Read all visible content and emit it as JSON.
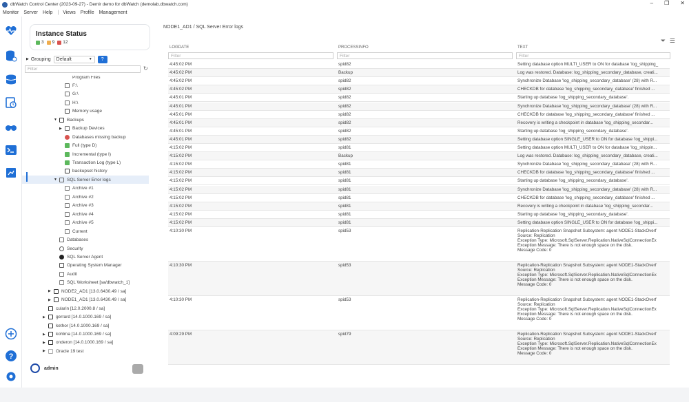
{
  "window": {
    "title": "dbWatch Control Center (2023-09-27) - Demir demo for dbWatch (demolab.dbwatch.com)",
    "minimize": "–",
    "maximize": "❐",
    "close": "✕"
  },
  "menu": [
    "Monitor",
    "Server",
    "Help",
    "|",
    "Views",
    "Profile",
    "Management"
  ],
  "colors": {
    "green": "#5cb85c",
    "orange": "#f0ad4e",
    "red": "#d9534f",
    "accent": "#1f6fd6"
  },
  "status": {
    "title": "Instance Status",
    "green_count": "3",
    "orange_count": "9",
    "red_count": "12"
  },
  "grouping": {
    "label": "Grouping",
    "value": "Default",
    "help": "?"
  },
  "tree_filter_placeholder": "Filter",
  "tree": [
    {
      "label": "Program Files",
      "indent": 3
    },
    {
      "label": "F:\\",
      "indent": 3,
      "icon": "drive-icon"
    },
    {
      "label": "G:\\",
      "indent": 3,
      "icon": "drive-icon"
    },
    {
      "label": "H:\\",
      "indent": 3,
      "icon": "drive-icon"
    },
    {
      "label": "Memory usage",
      "indent": 3,
      "icon": "memory-icon"
    },
    {
      "label": "Backups",
      "indent": 2,
      "icon": "folder-icon",
      "arrow": "▼"
    },
    {
      "label": "Backup Devices",
      "indent": 3,
      "icon": "device-icon",
      "arrow": "▶"
    },
    {
      "label": "Databases missing backup",
      "indent": 3,
      "icon": "error-icon"
    },
    {
      "label": "Full (type D)",
      "indent": 3,
      "icon": "check-icon"
    },
    {
      "label": "Incremental (type I)",
      "indent": 3,
      "icon": "check-icon"
    },
    {
      "label": "Transaction Log (type L)",
      "indent": 3,
      "icon": "check-icon"
    },
    {
      "label": "backupset history",
      "indent": 3,
      "icon": "table-icon"
    },
    {
      "label": "SQL Server Error logs",
      "indent": 2,
      "icon": "log-icon",
      "arrow": "▼",
      "selected": true
    },
    {
      "label": "Archive #1",
      "indent": 3,
      "icon": "doc-icon"
    },
    {
      "label": "Archive #2",
      "indent": 3,
      "icon": "doc-icon"
    },
    {
      "label": "Archive #3",
      "indent": 3,
      "icon": "doc-icon"
    },
    {
      "label": "Archive #4",
      "indent": 3,
      "icon": "doc-icon"
    },
    {
      "label": "Archive #5",
      "indent": 3,
      "icon": "doc-icon"
    },
    {
      "label": "Current",
      "indent": 3,
      "icon": "doc-icon"
    },
    {
      "label": "Databases",
      "indent": 2,
      "icon": "db-icon"
    },
    {
      "label": "Security",
      "indent": 2,
      "icon": "globe-icon"
    },
    {
      "label": "SQL Server Agent",
      "indent": 2,
      "icon": "agent-icon"
    },
    {
      "label": "Operating System Manager",
      "indent": 2,
      "icon": "os-icon"
    },
    {
      "label": "Audit",
      "indent": 2,
      "icon": "doc-icon"
    },
    {
      "label": "SQL Worksheet [sa/dbwatch_1]",
      "indent": 2,
      "icon": "sheet-icon"
    },
    {
      "label": "NODE2_AD1 [13.0.6430.49 / sa]",
      "indent": 1,
      "icon": "server-icon",
      "arrow": "▶"
    },
    {
      "label": "NODE1_AD1 [13.0.6430.49 / sa]",
      "indent": 1,
      "icon": "server-icon",
      "arrow": "▶"
    },
    {
      "label": "cularin [12.0.2000.8 / sa]",
      "indent": 0,
      "icon": "server-icon"
    },
    {
      "label": "gerrard [14.0.1000.169 / sa]",
      "indent": 0,
      "icon": "server-icon",
      "arrow": "▶"
    },
    {
      "label": "kethor [14.0.1000.169 / sa]",
      "indent": 0,
      "icon": "server-icon"
    },
    {
      "label": "kohlma [14.0.1000.169 / sa]",
      "indent": 0,
      "icon": "server-icon",
      "arrow": "▶"
    },
    {
      "label": "onderon [14.0.1000.169 / sa]",
      "indent": 0,
      "icon": "server-icon",
      "arrow": "▶"
    },
    {
      "label": "Oracle 19 test",
      "indent": 0,
      "icon": "oracle-icon",
      "arrow": "▶"
    }
  ],
  "user": {
    "name": "admin"
  },
  "breadcrumb": "NODE1_AD1 / SQL Server Error logs",
  "grid": {
    "columns": [
      "LOGDATE",
      "PROCESSINFO",
      "TEXT"
    ],
    "filter_placeholder": "Filter",
    "rows": [
      {
        "date": "4:45:02 PM",
        "proc": "spid82",
        "text": "Setting database option MULTI_USER to ON for database 'log_shipping_"
      },
      {
        "date": "4:45:02 PM",
        "proc": "Backup",
        "text": "Log was restored. Database: log_shipping_secondary_database, creati..."
      },
      {
        "date": "4:45:02 PM",
        "proc": "spid82",
        "text": "Synchronize Database 'log_shipping_secondary_database' (28) with R..."
      },
      {
        "date": "4:45:02 PM",
        "proc": "spid82",
        "text": "CHECKDB for database 'log_shipping_secondary_database' finished ..."
      },
      {
        "date": "4:45:01 PM",
        "proc": "spid82",
        "text": "Starting up database 'log_shipping_secondary_database'."
      },
      {
        "date": "4:45:01 PM",
        "proc": "spid82",
        "text": "Synchronize Database 'log_shipping_secondary_database' (28) with R..."
      },
      {
        "date": "4:45:01 PM",
        "proc": "spid82",
        "text": "CHECKDB for database 'log_shipping_secondary_database' finished ..."
      },
      {
        "date": "4:45:01 PM",
        "proc": "spid82",
        "text": "Recovery is writing a checkpoint in database 'log_shipping_secondar..."
      },
      {
        "date": "4:45:01 PM",
        "proc": "spid82",
        "text": "Starting up database 'log_shipping_secondary_database'."
      },
      {
        "date": "4:45:01 PM",
        "proc": "spid82",
        "text": "Setting database option SINGLE_USER to ON for database 'log_shippi..."
      },
      {
        "date": "4:15:02 PM",
        "proc": "spid81",
        "text": "Setting database option MULTI_USER to ON for database 'log_shippin..."
      },
      {
        "date": "4:15:02 PM",
        "proc": "Backup",
        "text": "Log was restored. Database: log_shipping_secondary_database, creati..."
      },
      {
        "date": "4:15:02 PM",
        "proc": "spid81",
        "text": "Synchronize Database 'log_shipping_secondary_database' (28) with R..."
      },
      {
        "date": "4:15:02 PM",
        "proc": "spid81",
        "text": "CHECKDB for database 'log_shipping_secondary_database' finished ..."
      },
      {
        "date": "4:15:02 PM",
        "proc": "spid81",
        "text": "Starting up database 'log_shipping_secondary_database'."
      },
      {
        "date": "4:15:02 PM",
        "proc": "spid81",
        "text": "Synchronize Database 'log_shipping_secondary_database' (28) with R..."
      },
      {
        "date": "4:15:02 PM",
        "proc": "spid81",
        "text": "CHECKDB for database 'log_shipping_secondary_database' finished ..."
      },
      {
        "date": "4:15:02 PM",
        "proc": "spid81",
        "text": "Recovery is writing a checkpoint in database 'log_shipping_secondar..."
      },
      {
        "date": "4:15:02 PM",
        "proc": "spid81",
        "text": "Starting up database 'log_shipping_secondary_database'."
      },
      {
        "date": "4:15:02 PM",
        "proc": "spid81",
        "text": "Setting database option SINGLE_USER to ON for database 'log_shippi..."
      },
      {
        "date": "4:10:30 PM",
        "proc": "spid53",
        "text": "Replication-Replication Snapshot Subsystem: agent NODE1-StackOverf\nSource: Replication\nException Type: Microsoft.SqlServer.Replication.NativeSqlConnectionEx\nException Message: There is not enough space on the disk.\nMessage Code: 0"
      },
      {
        "date": "4:10:30 PM",
        "proc": "spid53",
        "text": "Replication-Replication Snapshot Subsystem: agent NODE1-StackOverf\nSource: Replication\nException Type: Microsoft.SqlServer.Replication.NativeSqlConnectionEx\nException Message: There is not enough space on the disk.\nMessage Code: 0"
      },
      {
        "date": "4:10:30 PM",
        "proc": "spid53",
        "text": "Replication-Replication Snapshot Subsystem: agent NODE1-StackOverf\nSource: Replication\nException Type: Microsoft.SqlServer.Replication.NativeSqlConnectionEx\nException Message: There is not enough space on the disk.\nMessage Code: 0"
      },
      {
        "date": "4:09:29 PM",
        "proc": "spid79",
        "text": "Replication-Replication Snapshot Subsystem: agent NODE1-StackOverf\nSource: Replication\nException Type: Microsoft.SqlServer.Replication.NativeSqlConnectionEx\nException Message: There is not enough space on the disk.\nMessage Code: 0"
      }
    ]
  },
  "icons": {
    "filter": "filter-icon",
    "menu": "hamburger-icon"
  }
}
